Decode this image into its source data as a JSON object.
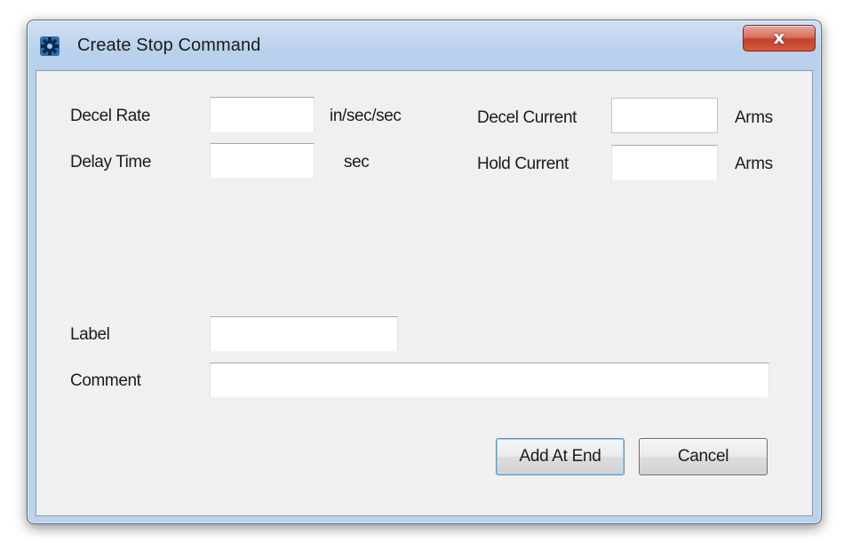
{
  "window": {
    "title": "Create Stop Command",
    "close_label": "x"
  },
  "form": {
    "decel_rate": {
      "label": "Decel Rate",
      "value": "",
      "unit": "in/sec/sec"
    },
    "delay_time": {
      "label": "Delay Time",
      "value": "",
      "unit": "sec"
    },
    "decel_current": {
      "label": "Decel Current",
      "value": "",
      "unit": "Arms"
    },
    "hold_current": {
      "label": "Hold Current",
      "value": "",
      "unit": "Arms"
    },
    "label": {
      "label": "Label",
      "value": ""
    },
    "comment": {
      "label": "Comment",
      "value": ""
    }
  },
  "buttons": {
    "add_at_end": "Add At End",
    "cancel": "Cancel"
  },
  "colors": {
    "title_bar": "#bcd3ec",
    "client_bg": "#f0f0f0",
    "close_button": "#c4412b"
  },
  "icons": {
    "app": "gear-icon",
    "close": "close-icon"
  }
}
